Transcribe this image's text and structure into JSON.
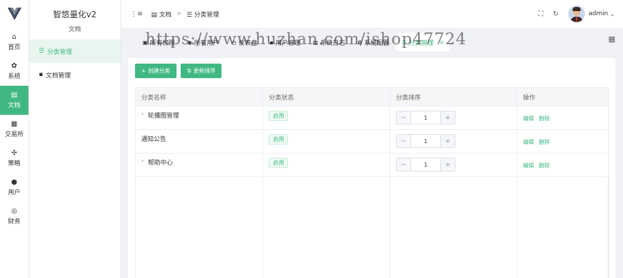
{
  "rail": {
    "items": [
      {
        "label": "首页",
        "icon": "home-icon",
        "glyph": "⌂"
      },
      {
        "label": "系统",
        "icon": "gear-icon",
        "glyph": "✿"
      },
      {
        "label": "文档",
        "icon": "document-icon",
        "glyph": "▤"
      },
      {
        "label": "交易所",
        "icon": "exchange-icon",
        "glyph": "▦"
      },
      {
        "label": "策略",
        "icon": "strategy-icon",
        "glyph": "✣"
      },
      {
        "label": "用户",
        "icon": "user-icon",
        "glyph": "●"
      },
      {
        "label": "财务",
        "icon": "finance-icon",
        "glyph": "◎"
      }
    ],
    "active_index": 2
  },
  "submenu": {
    "title": "智悠量化v2",
    "subtitle": "文档",
    "items": [
      {
        "label": "分类管理",
        "icon": "list-icon",
        "glyph": "☰"
      },
      {
        "label": "文档管理",
        "icon": "file-icon",
        "glyph": "▪"
      }
    ],
    "active_index": 0
  },
  "header": {
    "fold_icon": "⋮≡",
    "breadcrumb": [
      {
        "label": "文档",
        "glyph": "▤"
      },
      {
        "label": "分类管理",
        "glyph": "☰"
      }
    ],
    "separator": ">",
    "fullscreen_glyph": "⛶",
    "refresh_glyph": "↻",
    "user_name": "admin",
    "caret": "⌄"
  },
  "tabs": {
    "items": [
      {
        "label": "所有权限",
        "glyph": "▣"
      },
      {
        "label": "所有用户",
        "glyph": "◉"
      },
      {
        "label": "仪表盘",
        "glyph": "◷"
      },
      {
        "label": "用户管理",
        "glyph": "▪"
      },
      {
        "label": "系统日志",
        "glyph": "▥"
      },
      {
        "label": "系统配置",
        "glyph": "✿"
      },
      {
        "label": "分类管理",
        "glyph": "☰",
        "active": true
      }
    ],
    "close_glyph": "×",
    "menu_glyph": "▦"
  },
  "watermark": "https://www.huzhan.com/ishop47724",
  "toolbar": {
    "create_label": "创建分类",
    "create_glyph": "+",
    "sort_label": "更新排序",
    "sort_glyph": "⇅"
  },
  "table": {
    "columns": [
      "分类名称",
      "分类状态",
      "分类排序",
      "操作"
    ],
    "rows": [
      {
        "name": "轮播图管理",
        "expandable": true,
        "status": "启用",
        "sort": "1",
        "edit": "编辑",
        "delete": "删除"
      },
      {
        "name": "通知公告",
        "expandable": false,
        "status": "启用",
        "sort": "1",
        "edit": "编辑",
        "delete": "删除"
      },
      {
        "name": "帮助中心",
        "expandable": true,
        "status": "启用",
        "sort": "1",
        "edit": "编辑",
        "delete": "删除"
      }
    ],
    "stepper_minus": "−",
    "stepper_plus": "+",
    "expand_glyph": "›"
  },
  "colors": {
    "accent": "#41b883",
    "background": "#f0f2f5"
  }
}
